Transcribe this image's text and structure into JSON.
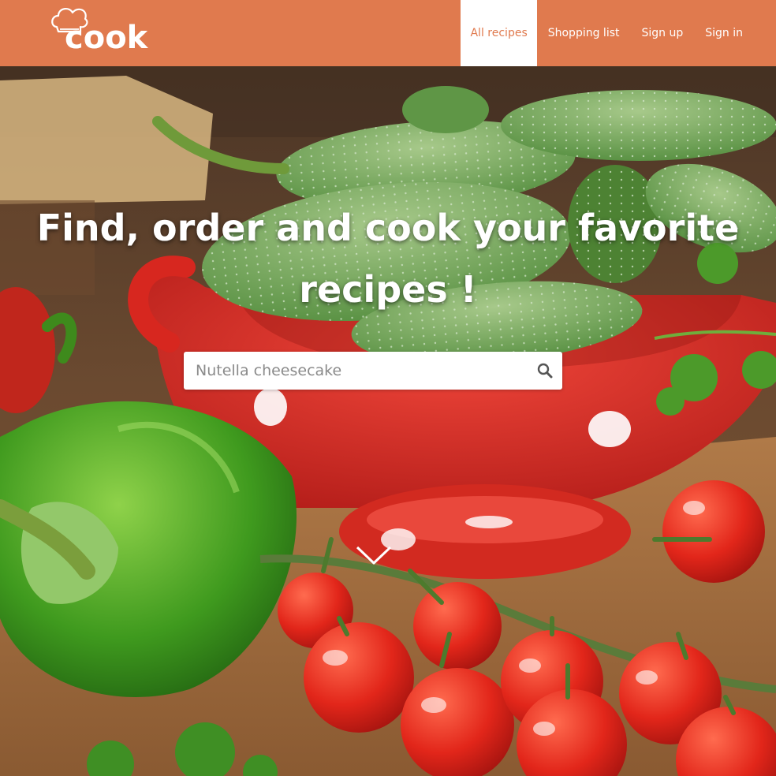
{
  "brand": {
    "logo_text": "cook",
    "logo_icon": "chef-hat-icon"
  },
  "nav": {
    "items": [
      {
        "label": "All recipes",
        "active": true
      },
      {
        "label": "Shopping list",
        "active": false
      },
      {
        "label": "Sign up",
        "active": false
      },
      {
        "label": "Sign in",
        "active": false
      }
    ]
  },
  "hero": {
    "headline_line1": "Find, order and cook your favorite",
    "headline_line2": "recipes !",
    "search": {
      "placeholder": "Nutella cheesecake",
      "button_icon": "search-icon"
    },
    "scroll_icon": "chevron-down-icon"
  },
  "colors": {
    "brand": "#e07a4e",
    "nav_text": "#ffffff",
    "active_text": "#e07a4e"
  }
}
